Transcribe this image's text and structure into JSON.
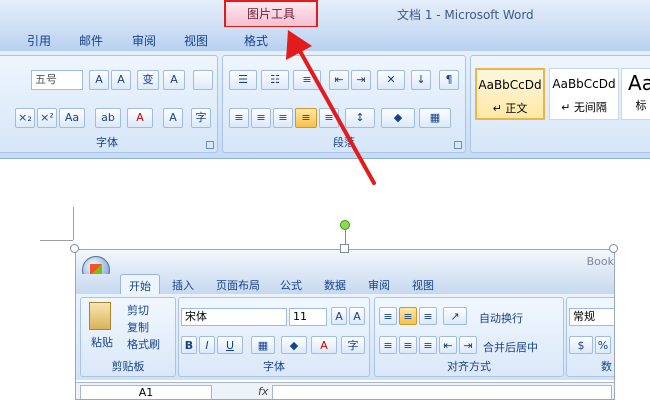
{
  "word": {
    "contextual_tab": "图片工具",
    "window_title": "文档 1 - Microsoft Word",
    "tabs": [
      "引用",
      "邮件",
      "审阅",
      "视图",
      "格式"
    ],
    "font_size_value": "五号",
    "group_font_label": "字体",
    "group_paragraph_label": "段落",
    "styles": [
      {
        "sample": "AaBbCcDd",
        "name": "↵ 正文"
      },
      {
        "sample": "AaBbCcDd",
        "name": "↵ 无间隔"
      },
      {
        "sample": "Aa",
        "name": "标"
      }
    ],
    "font_buttons_row1": [
      "A",
      "A",
      "变",
      "A"
    ],
    "font_buttons_row2": [
      "×₂",
      "×²",
      "Aa",
      "ab",
      "A",
      "A",
      "字"
    ]
  },
  "excel": {
    "tabs": [
      "开始",
      "插入",
      "页面布局",
      "公式",
      "数据",
      "审阅",
      "视图"
    ],
    "book_title": "Book",
    "clipboard": {
      "paste": "粘贴",
      "cut": "剪切",
      "copy": "复制",
      "format_painter": "格式刷",
      "label": "剪贴板"
    },
    "font": {
      "name": "宋体",
      "size": "11",
      "label": "字体",
      "bold": "B",
      "italic": "I",
      "underline": "U"
    },
    "alignment": {
      "wrap": "自动换行",
      "merge": "合并后居中",
      "label": "对齐方式"
    },
    "number": {
      "format": "常规",
      "label": "数",
      "percent": "%"
    },
    "name_box": "A1",
    "fx": "fx"
  },
  "colors": {
    "highlight_box": "#e31b1b",
    "arrow": "#e31b1b",
    "ribbon_blue": "#15428b"
  }
}
